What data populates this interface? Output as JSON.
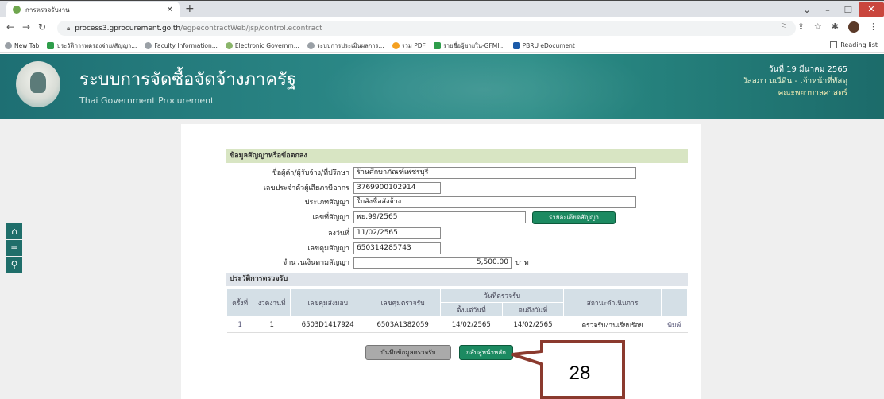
{
  "browser": {
    "tab_title": "การตรวจรับงาน",
    "url_host": "process3.gprocurement.go.th",
    "url_path": "/egpecontractWeb/jsp/control.econtract",
    "bookmarks": [
      {
        "label": "New Tab",
        "color": "#5f6368"
      },
      {
        "label": "ประวัติการทดรองจ่าย/สัญญา...",
        "color": "#2e9d4a"
      },
      {
        "label": "Faculty Information...",
        "color": "#5f6368"
      },
      {
        "label": "Electronic Governm...",
        "color": "#8ab56a"
      },
      {
        "label": "ระบบการประเมินผลการ...",
        "color": "#5f6368"
      },
      {
        "label": "รวม PDF",
        "color": "#f4a020"
      },
      {
        "label": "รายชื่อผู้ขายใน-GFMI...",
        "color": "#2e9d4a"
      },
      {
        "label": "PBRU eDocument",
        "color": "#1b5aa8"
      }
    ],
    "reading_list": "Reading list"
  },
  "header": {
    "title": "ระบบการจัดซื้อจัดจ้างภาครัฐ",
    "subtitle": "Thai Government Procurement",
    "date": "วันที่ 19 มีนาคม 2565",
    "user": "วัลลภา มณีดิน - เจ้าหน้าที่พัสดุ",
    "dept": "คณะพยาบาลศาสตร์"
  },
  "contract": {
    "section_title": "ข้อมูลสัญญาหรือข้อตกลง",
    "fields": [
      {
        "label": "ชื่อผู้ค้า/ผู้รับจ้าง/ที่ปรึกษา",
        "value": "ร้านศึกษาภัณฑ์เพชรบุรี"
      },
      {
        "label": "เลขประจำตัวผู้เสียภาษีอากร",
        "value": "3769900102914"
      },
      {
        "label": "ประเภทสัญญา",
        "value": "ใบสั่งซื้อสั่งจ้าง"
      },
      {
        "label": "เลขที่สัญญา",
        "value": "พย.99/2565"
      },
      {
        "label": "ลงวันที่",
        "value": "11/02/2565"
      },
      {
        "label": "เลขคุมสัญญา",
        "value": "650314285743"
      },
      {
        "label": "จำนวนเงินตามสัญญา",
        "value": "5,500.00"
      }
    ],
    "amount_unit": "บาท",
    "detail_button": "รายละเอียดสัญญา"
  },
  "history": {
    "section_title": "ประวัติการตรวจรับ",
    "headers": {
      "no": "ครั้งที่",
      "period": "งวดงานที่",
      "delivery_no": "เลขคุมส่งมอบ",
      "inspect_no": "เลขคุมตรวจรับ",
      "inspect_date": "วันที่ตรวจรับ",
      "from": "ตั้งแต่วันที่",
      "to": "จนถึงวันที่",
      "status": "สถานะดำเนินการ"
    },
    "rows": [
      {
        "no": "1",
        "period": "1",
        "delivery_no": "6503D1417924",
        "inspect_no": "6503A1382059",
        "from": "14/02/2565",
        "to": "14/02/2565",
        "status": "ตรวจรับงานเรียบร้อย",
        "action": "พิมพ์"
      }
    ]
  },
  "buttons": {
    "save": "บันทึกข้อมูลตรวจรับ",
    "back": "กลับสู่หน้าหลัก"
  },
  "annotation": {
    "label": "28",
    "color": "#8b3a2e"
  }
}
